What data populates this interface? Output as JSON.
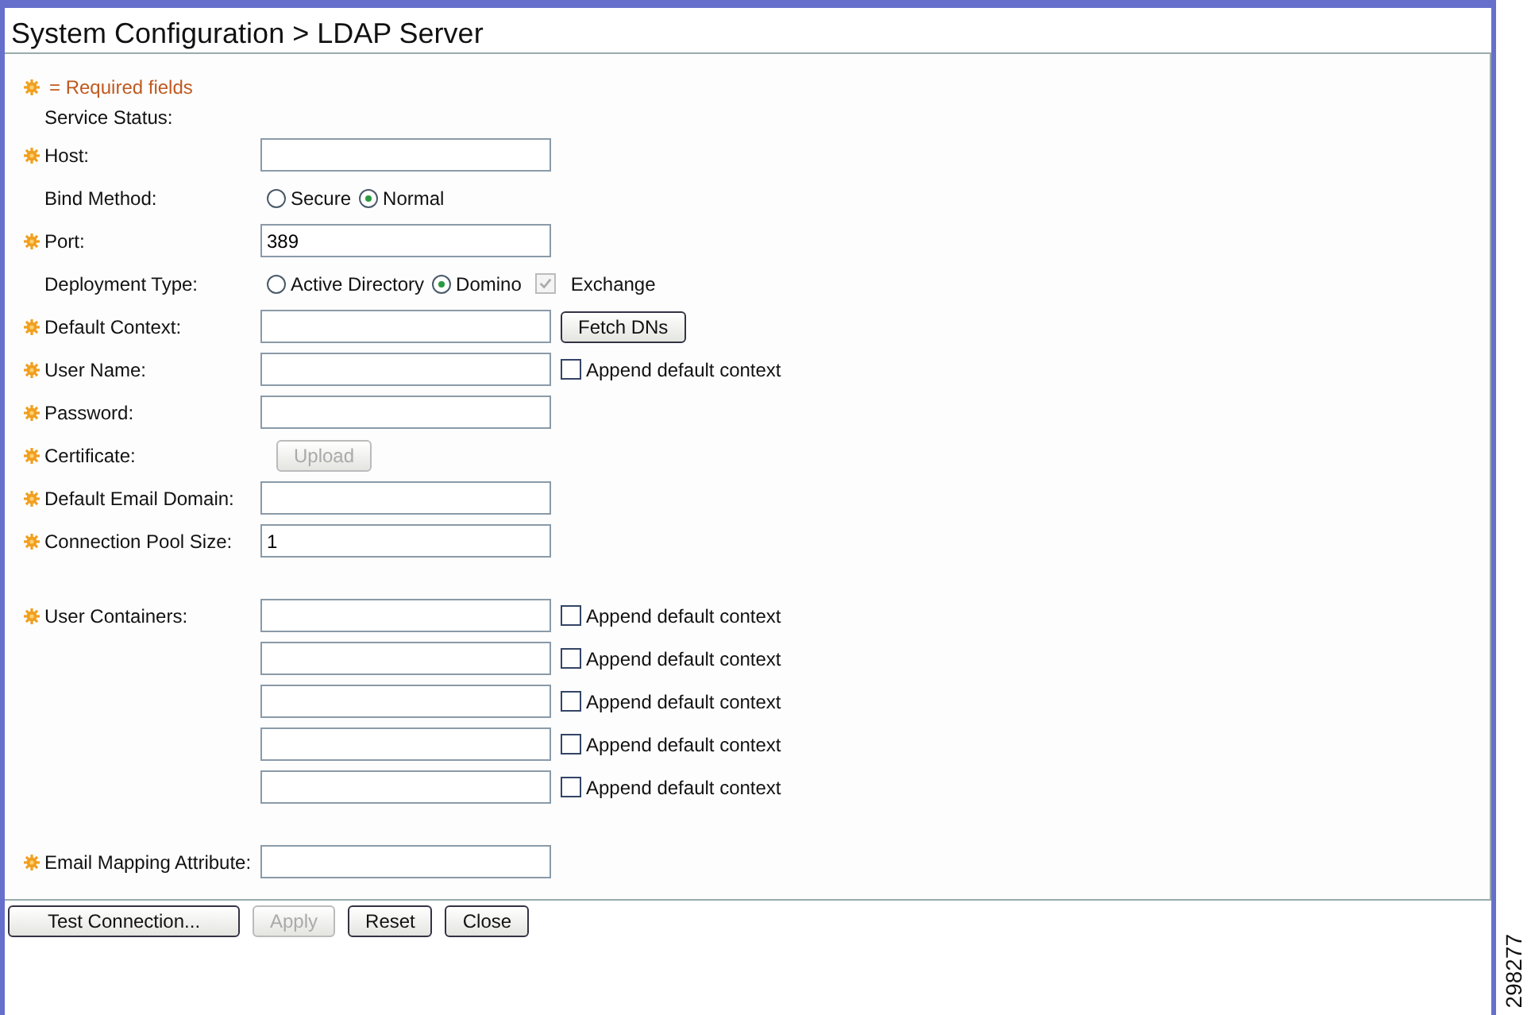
{
  "window": {
    "title": "System Configuration > LDAP Server"
  },
  "required_note": "= Required fields",
  "sections": [
    [
      {
        "kind": "status",
        "label": "Service Status:",
        "required": false
      },
      {
        "kind": "text",
        "label": "Host:",
        "required": true
      },
      {
        "kind": "choice",
        "label": "Bind Method:",
        "required": false,
        "options": [
          {
            "kind": "radio",
            "label": "Secure",
            "selected": false
          },
          {
            "kind": "radio",
            "label": "Normal",
            "selected": true
          }
        ]
      },
      {
        "kind": "text",
        "label": "Port:",
        "required": true,
        "value": "389"
      },
      {
        "kind": "choice",
        "label": "Deployment Type:",
        "required": false,
        "options": [
          {
            "kind": "radio",
            "label": "Active Directory",
            "selected": false
          },
          {
            "kind": "radio",
            "label": "Domino",
            "selected": true
          },
          {
            "kind": "checkbox",
            "label": "Exchange",
            "selected": true,
            "disabled": true
          }
        ]
      },
      {
        "kind": "text",
        "label": "Default Context:",
        "required": true,
        "button": {
          "label": "Fetch DNs",
          "disabled": false
        }
      },
      {
        "kind": "text",
        "label": "User Name:",
        "required": true,
        "append": {
          "label": "Append default context",
          "checked": false
        }
      },
      {
        "kind": "text",
        "label": "Password:",
        "required": true
      },
      {
        "kind": "button",
        "label": "Certificate:",
        "required": true,
        "button": {
          "label": "Upload",
          "disabled": true
        }
      },
      {
        "kind": "text",
        "label": "Default Email Domain:",
        "required": true
      },
      {
        "kind": "text",
        "label": "Connection Pool Size:",
        "required": true,
        "value": "1"
      }
    ],
    [
      {
        "kind": "multi",
        "label": "User Containers:",
        "required": true,
        "fields": [
          {
            "append": {
              "label": "Append default context",
              "checked": false
            }
          },
          {
            "append": {
              "label": "Append default context",
              "checked": false
            }
          },
          {
            "append": {
              "label": "Append default context",
              "checked": false
            }
          },
          {
            "append": {
              "label": "Append default context",
              "checked": false
            }
          },
          {
            "append": {
              "label": "Append default context",
              "checked": false
            }
          }
        ]
      }
    ],
    [
      {
        "kind": "text",
        "label": "Email Mapping Attribute:",
        "required": true
      }
    ]
  ],
  "buttons": [
    {
      "label": "Test Connection...",
      "disabled": false
    },
    {
      "label": "Apply",
      "disabled": true
    },
    {
      "label": "Reset",
      "disabled": false
    },
    {
      "label": "Close",
      "disabled": false
    }
  ],
  "figure_number": "298277"
}
